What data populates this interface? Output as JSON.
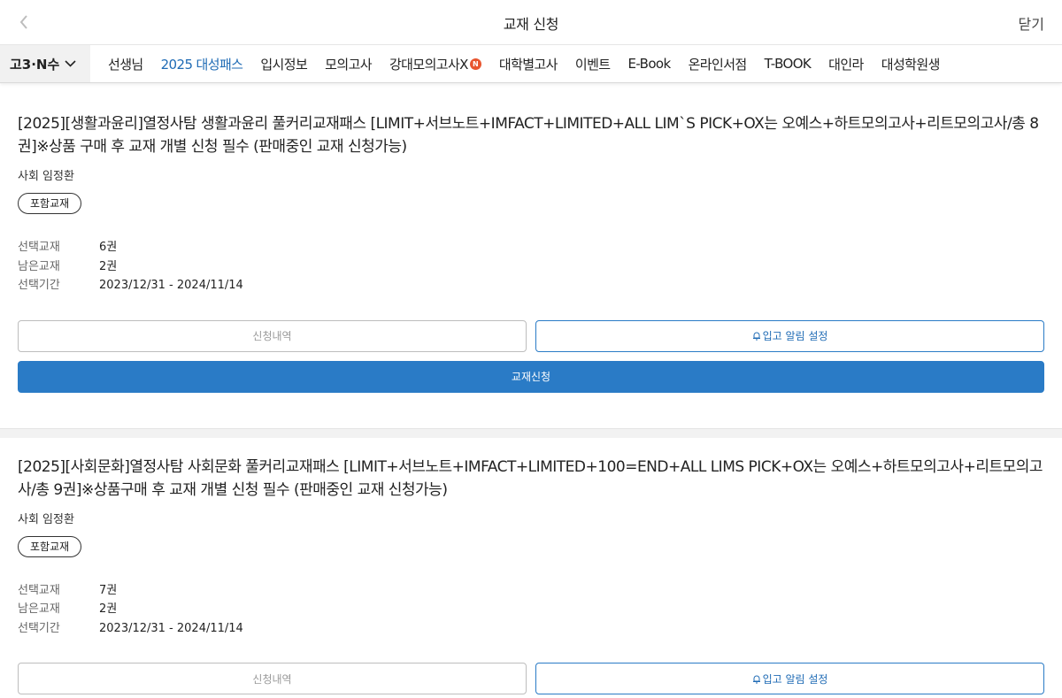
{
  "header": {
    "title": "교재 신청",
    "close_label": "닫기"
  },
  "nav": {
    "grade": "고3·N수",
    "items": [
      {
        "label": "선생님"
      },
      {
        "label": "2025 대성패스"
      },
      {
        "label": "입시정보"
      },
      {
        "label": "모의고사"
      },
      {
        "label": "강대모의고사X"
      },
      {
        "label": "대학별고사"
      },
      {
        "label": "이벤트"
      },
      {
        "label": "E-Book"
      },
      {
        "label": "온라인서점"
      },
      {
        "label": "T-BOOK"
      },
      {
        "label": "대인라"
      },
      {
        "label": "대성학원생"
      }
    ],
    "new_badge": "N"
  },
  "cards": [
    {
      "title": "[2025][생활과윤리]열정사탐 생활과윤리 풀커리교재패스 [LIMIT+서브노트+IMFACT+LIMITED+ALL LIM`S PICK+OX는 오예스+하트모의고사+리트모의고사/총 8권]※상품 구매 후 교재 개별 신청 필수 (판매중인 교재 신청가능)",
      "teacher": "사회 임정환",
      "tag": "포함교재",
      "rows": [
        {
          "label": "선택교재",
          "value": "6권"
        },
        {
          "label": "남은교재",
          "value": "2권"
        },
        {
          "label": "선택기간",
          "value": "2023/12/31 - 2024/11/14"
        }
      ],
      "history_label": "신청내역",
      "alert_label": "입고 알림 설정",
      "apply_label": "교재신청"
    },
    {
      "title": "[2025][사회문화]열정사탐 사회문화 풀커리교재패스 [LIMIT+서브노트+IMFACT+LIMITED+100=END+ALL LIMS PICK+OX는 오예스+하트모의고사+리트모의고사/총 9권]※상품구매 후 교재 개별 신청 필수 (판매중인 교재 신청가능)",
      "teacher": "사회 임정환",
      "tag": "포함교재",
      "rows": [
        {
          "label": "선택교재",
          "value": "7권"
        },
        {
          "label": "남은교재",
          "value": "2권"
        },
        {
          "label": "선택기간",
          "value": "2023/12/31 - 2024/11/14"
        }
      ],
      "history_label": "신청내역",
      "alert_label": "입고 알림 설정"
    }
  ],
  "colors": {
    "accent": "#2a7bc6",
    "active_nav": "#1f6bb5",
    "badge": "#e8552f"
  }
}
